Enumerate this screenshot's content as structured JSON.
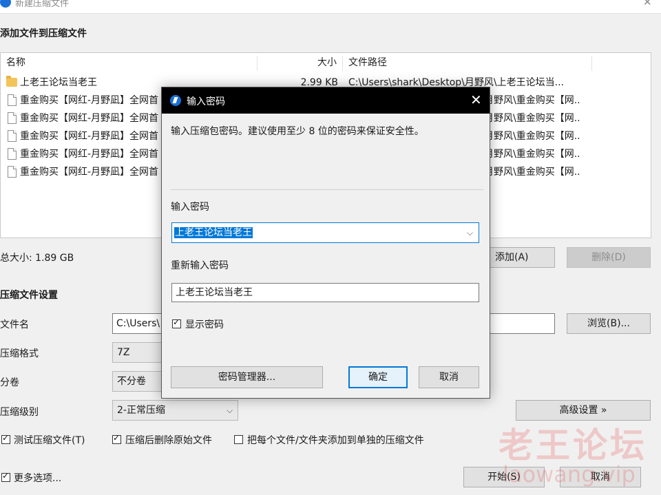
{
  "window": {
    "title": "新建压缩文件",
    "close_glyph": "✕",
    "icon": "app-logo-icon"
  },
  "add_section": {
    "heading": "添加文件到压缩文件",
    "columns": {
      "name": "名称",
      "size": "大小",
      "path": "文件路径"
    },
    "rows": [
      {
        "type": "folder",
        "name": "上老王论坛当老王",
        "size": "2.99 KB",
        "path": "C:\\Users\\shark\\Desktop\\月野风\\上老王论坛当..."
      },
      {
        "type": "file",
        "name": "重金购买【网红-月野凪】全网首",
        "size": "",
        "path": "月野风\\重金购买【网..."
      },
      {
        "type": "file",
        "name": "重金购买【网红-月野凪】全网首",
        "size": "",
        "path": "月野风\\重金购买【网..."
      },
      {
        "type": "file",
        "name": "重金购买【网红-月野凪】全网首",
        "size": "",
        "path": "月野风\\重金购买【网..."
      },
      {
        "type": "file",
        "name": "重金购买【网红-月野凪】全网首",
        "size": "",
        "path": "月野风\\重金购买【网..."
      },
      {
        "type": "file",
        "name": "重金购买【网红-月野凪】全网首",
        "size": "",
        "path": "月野风\\重金购买【网..."
      }
    ],
    "total_size": "总大小: 1.89 GB",
    "add_button": "添加(A)",
    "delete_button": "删除(D)"
  },
  "settings": {
    "heading": "压缩文件设置",
    "filename_label": "文件名",
    "filename_value": "C:\\Users\\",
    "browse_button": "浏览(B)...",
    "format_label": "压缩格式",
    "format_value": "7Z",
    "volume_label": "分卷",
    "volume_value": "不分卷",
    "level_label": "压缩级别",
    "level_value": "2-正常压缩",
    "advanced_button": "高级设置 »",
    "test_checkbox": "测试压缩文件(T)",
    "delete_after_checkbox": "压缩后删除原始文件",
    "separate_checkbox": "把每个文件/文件夹添加到单独的压缩文件",
    "more_options": "更多选项...",
    "start_button": "开始(S)",
    "cancel_button": "取消"
  },
  "dialog": {
    "title": "输入密码",
    "close_glyph": "✕",
    "hint": "输入压缩包密码。建议使用至少 8 位的密码来保证安全性。",
    "password_label": "输入密码",
    "password_value": "上老王论坛当老王",
    "confirm_label": "重新输入密码",
    "confirm_value": "上老王论坛当老王",
    "show_password": "显示密码",
    "manager_button": "密码管理器...",
    "ok_button": "确定",
    "cancel_button": "取消"
  },
  "watermark": {
    "text": "老王论坛",
    "site": "laowang.vip"
  },
  "colors": {
    "accent": "#0078d7",
    "dialog_title_bg": "#000000",
    "watermark": "#e83c3c"
  }
}
